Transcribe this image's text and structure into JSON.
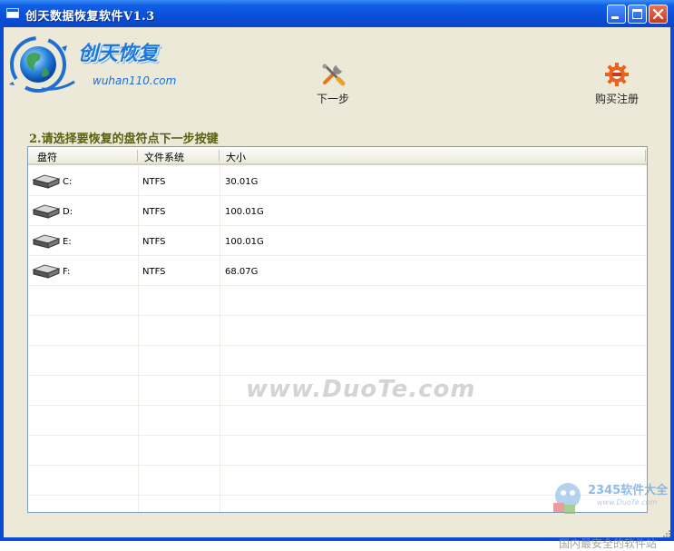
{
  "window": {
    "title": "创天数据恢复软件V1.3"
  },
  "logo": {
    "title": "创天恢复",
    "url": "wuhan110.com"
  },
  "toolbar": {
    "next_label": "下一步",
    "next_icon": "wrench-screwdriver-icon",
    "register_label": "购买注册",
    "register_icon": "gear-icon"
  },
  "instruction": "2.请选择要恢复的盘符点下一步按键",
  "table": {
    "columns": [
      "盘符",
      "文件系统",
      "大小"
    ],
    "rows": [
      {
        "drive": "C:",
        "fs": "NTFS",
        "size": "30.01G"
      },
      {
        "drive": "D:",
        "fs": "NTFS",
        "size": "100.01G"
      },
      {
        "drive": "E:",
        "fs": "NTFS",
        "size": "100.01G"
      },
      {
        "drive": "F:",
        "fs": "NTFS",
        "size": "68.07G"
      }
    ]
  },
  "watermark": "www.DuoTe.com",
  "corner_badge": {
    "line1": "2345软件大全",
    "line2": "www.DuoTe.com",
    "caption": "国内最安全的软件站"
  },
  "colors": {
    "titlebar": "#0a4fd8",
    "client_bg": "#ece9d8",
    "instruction": "#5a6010",
    "logo": "#1a78e0"
  }
}
